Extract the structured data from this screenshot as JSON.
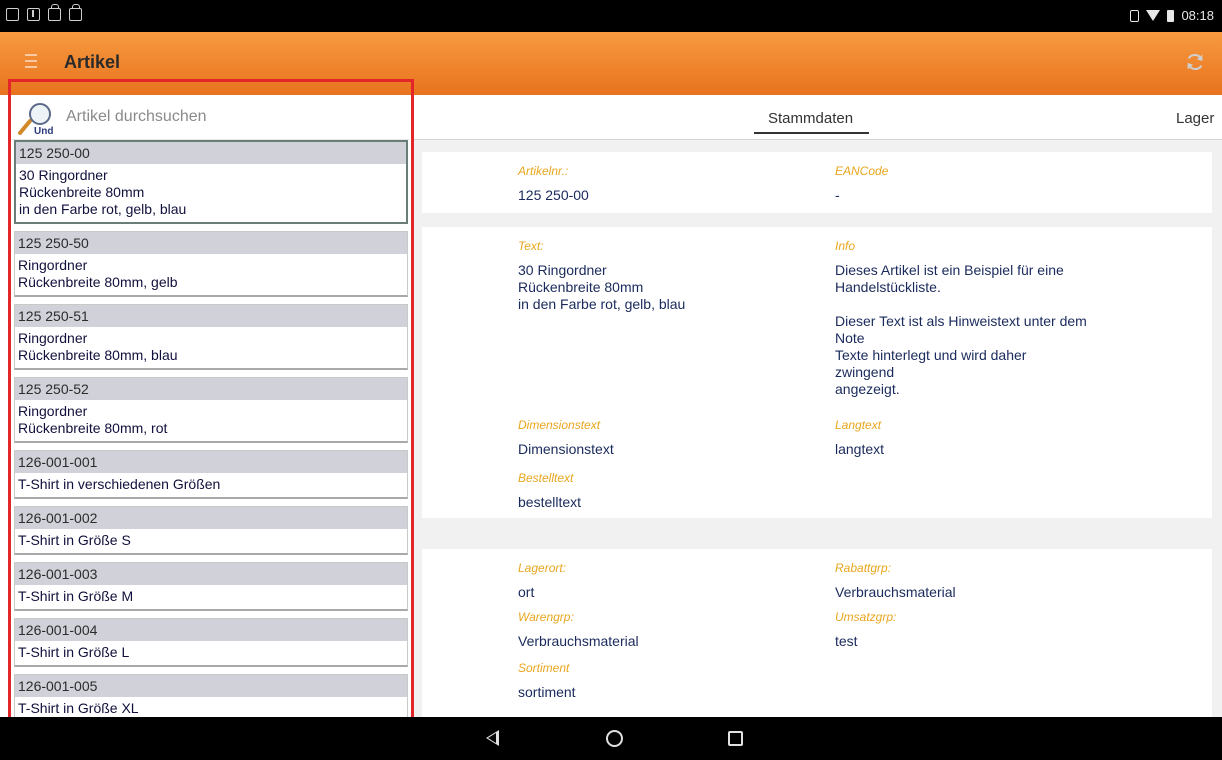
{
  "status_bar": {
    "time": "08:18"
  },
  "app_bar": {
    "title": "Artikel"
  },
  "search": {
    "placeholder": "Artikel durchsuchen",
    "icon_label": "Und"
  },
  "list": [
    {
      "num": "125 250-00",
      "lines": [
        "30 Ringordner",
        "Rückenbreite 80mm",
        "in den Farbe rot, gelb, blau"
      ],
      "selected": true
    },
    {
      "num": "125 250-50",
      "lines": [
        "Ringordner",
        "Rückenbreite 80mm, gelb"
      ]
    },
    {
      "num": "125 250-51",
      "lines": [
        "Ringordner",
        "Rückenbreite 80mm, blau"
      ]
    },
    {
      "num": "125 250-52",
      "lines": [
        "Ringordner",
        "Rückenbreite 80mm, rot"
      ]
    },
    {
      "num": "126-001-001",
      "lines": [
        "T-Shirt in verschiedenen Größen"
      ]
    },
    {
      "num": "126-001-002",
      "lines": [
        "T-Shirt in Größe S"
      ]
    },
    {
      "num": "126-001-003",
      "lines": [
        "T-Shirt in Größe M"
      ]
    },
    {
      "num": "126-001-004",
      "lines": [
        "T-Shirt in Größe L"
      ]
    },
    {
      "num": "126-001-005",
      "lines": [
        "T-Shirt in Größe XL"
      ]
    }
  ],
  "tabs": {
    "stammdaten": "Stammdaten",
    "lager": "Lager"
  },
  "details": {
    "artikelnr_label": "Artikelnr.:",
    "artikelnr_value": "125 250-00",
    "eancode_label": "EANCode",
    "eancode_value": "-",
    "text_label": "Text:",
    "text_lines": [
      "30 Ringordner",
      "Rückenbreite 80mm",
      "in den Farbe rot, gelb, blau"
    ],
    "info_label": "Info",
    "info_lines": [
      "Dieses Artikel ist ein Beispiel für eine",
      "Handelstückliste.",
      "",
      "Dieser Text ist als Hinweistext unter dem",
      "Note",
      "Texte hinterlegt und wird daher",
      "zwingend",
      "angezeigt."
    ],
    "dimensionstext_label": "Dimensionstext",
    "dimensionstext_value": "Dimensionstext",
    "langtext_label": "Langtext",
    "langtext_value": "langtext",
    "bestelltext_label": "Bestelltext",
    "bestelltext_value": "bestelltext",
    "lagerort_label": "Lagerort:",
    "lagerort_value": "ort",
    "rabattgrp_label": "Rabattgrp:",
    "rabattgrp_value": "Verbrauchsmaterial",
    "warengrp_label": "Warengrp:",
    "warengrp_value": "Verbrauchsmaterial",
    "umsatzgrp_label": "Umsatzgrp:",
    "umsatzgrp_value": "test",
    "sortiment_label": "Sortiment",
    "sortiment_value": "sortiment"
  },
  "colors": {
    "accent": "#f08a30",
    "label": "#e8a61e",
    "value": "#1a2a5c",
    "highlight": "#e2262a"
  }
}
